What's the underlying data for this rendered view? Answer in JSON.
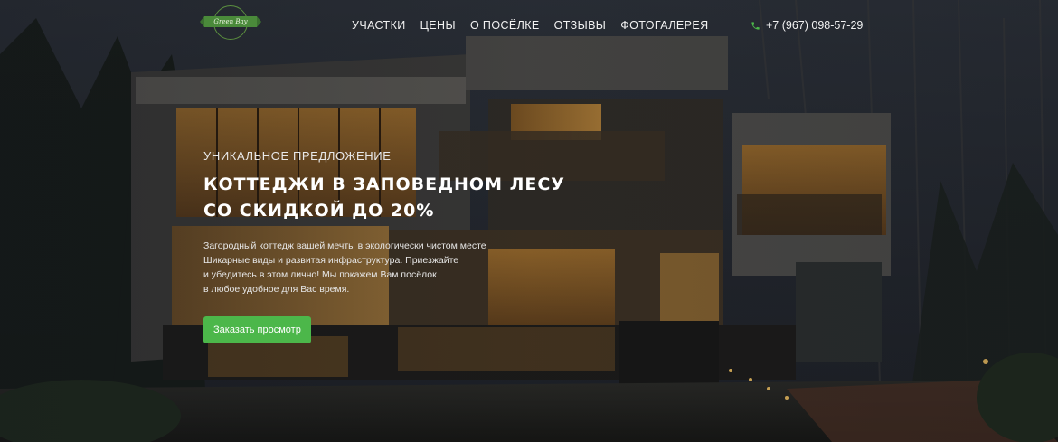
{
  "logo": {
    "text": "Green Bay"
  },
  "nav": {
    "items": [
      {
        "label": "УЧАСТКИ"
      },
      {
        "label": "ЦЕНЫ"
      },
      {
        "label": "О ПОСЁЛКЕ"
      },
      {
        "label": "ОТЗЫВЫ"
      },
      {
        "label": "ФОТОГАЛЕРЕЯ"
      }
    ]
  },
  "phone": {
    "icon": "phone-icon",
    "number": "+7 (967) 098-57-29"
  },
  "hero": {
    "kicker": "УНИКАЛЬНОЕ ПРЕДЛОЖЕНИЕ",
    "title_line1": "КОТТЕДЖИ В ЗАПОВЕДНОМ ЛЕСУ",
    "title_line2": "СО СКИДКОЙ ДО 20%",
    "desc_line1": "Загородный коттедж вашей мечты в экологически чистом месте",
    "desc_line2": "Шикарные виды и развитая инфраструктура. Приезжайте",
    "desc_line3": "и убедитесь в этом лично! Мы покажем Вам посёлок",
    "desc_line4": "в любое удобное для Вас время.",
    "cta_label": "Заказать просмотр"
  },
  "colors": {
    "accent": "#4cb74a",
    "logo_green": "#4a8a3a"
  }
}
